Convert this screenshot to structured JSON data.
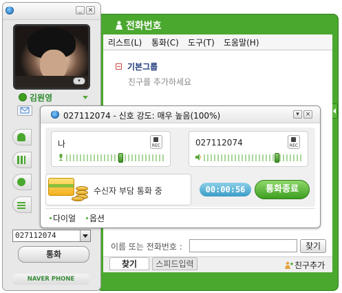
{
  "left_panel": {
    "user_name": "김원영",
    "dial_value": "027112074",
    "call_button": "통화",
    "brand": "NAVER PHONE"
  },
  "main_window": {
    "title": "전화번호",
    "menu": [
      "리스트(L)",
      "통화(C)",
      "도구(T)",
      "도움말(H)"
    ],
    "group_label": "기본그룹",
    "empty_hint": "친구를 추가하세요",
    "search_label": "이름 또는 전화번호 :",
    "search_button": "찾기",
    "tabs": [
      "찾기",
      "스피드입력"
    ],
    "add_friend": "친구추가"
  },
  "call_window": {
    "title": "027112074 - 신호 강도: 매우 높음(100%)",
    "me_label": "나",
    "remote_label": "027112074",
    "rec_label": "REC",
    "me_volume": 0.56,
    "remote_volume": 0.76,
    "status": "수신자 부담 통화 중",
    "timer": "00:00:56",
    "end_button": "통화종료",
    "footer": [
      "다이얼",
      "옵션"
    ]
  },
  "colors": {
    "accent": "#4aa82e",
    "timer": "#3b9dc6",
    "group": "#1c3a7a"
  }
}
